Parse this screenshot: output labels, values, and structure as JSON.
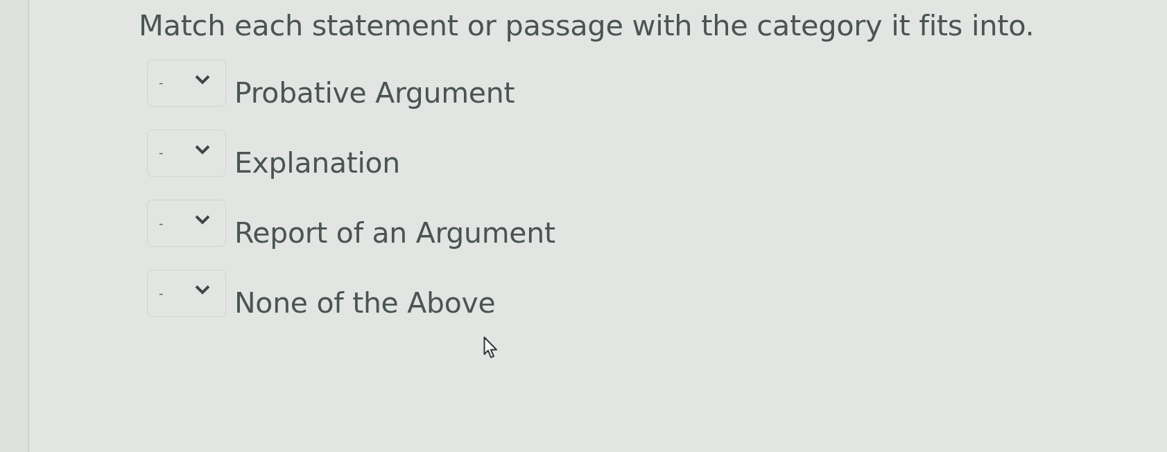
{
  "prompt": "Match each statement or passage with the category it fits into.",
  "items": [
    {
      "dropdown_value": "-",
      "label": "Probative Argument"
    },
    {
      "dropdown_value": "-",
      "label": "Explanation"
    },
    {
      "dropdown_value": "-",
      "label": "Report of an Argument"
    },
    {
      "dropdown_value": "-",
      "label": "None of the Above"
    }
  ]
}
